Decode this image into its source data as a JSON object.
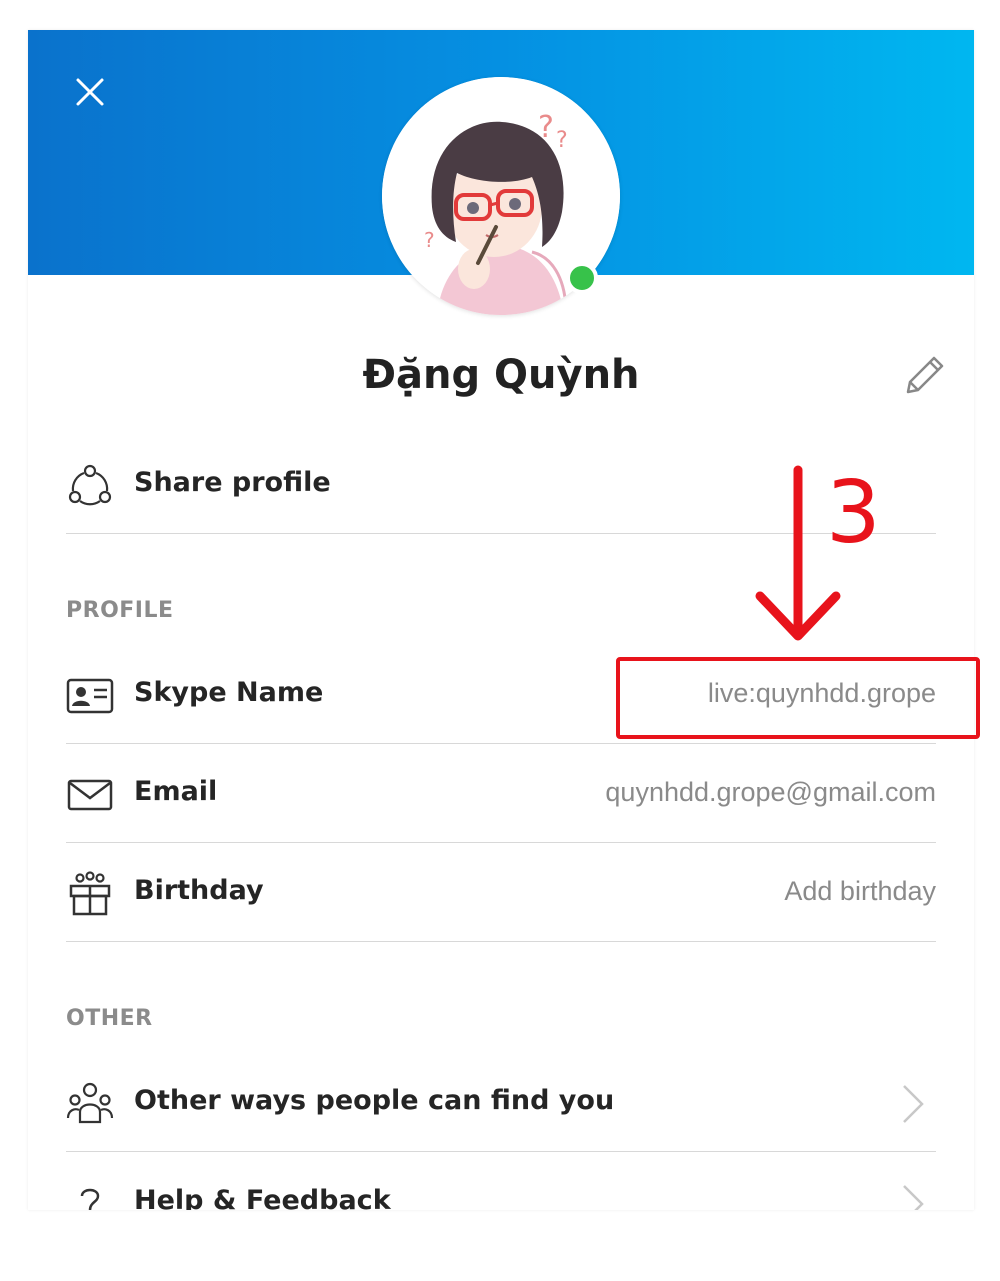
{
  "profile": {
    "name": "Đặng Quỳnh",
    "status": "online"
  },
  "actions": {
    "share_label": "Share profile"
  },
  "sections": {
    "profile_header": "PROFILE",
    "other_header": "OTHER"
  },
  "fields": [
    {
      "label": "Skype Name",
      "value": "live:quynhdd.grope",
      "icon": "contact-card-icon"
    },
    {
      "label": "Email",
      "value": "quynhdd.grope@gmail.com",
      "icon": "mail-icon"
    },
    {
      "label": "Birthday",
      "value": "Add birthday",
      "icon": "gift-icon"
    }
  ],
  "other": [
    {
      "label": "Other ways people can find you",
      "icon": "people-group-icon"
    },
    {
      "label": "Help & Feedback",
      "icon": "question-icon"
    }
  ],
  "annotation": {
    "step_number": "3",
    "color": "#e8131b"
  },
  "colors": {
    "header_start": "#0a72cc",
    "header_end": "#00b7f0",
    "presence": "#37c24a"
  }
}
